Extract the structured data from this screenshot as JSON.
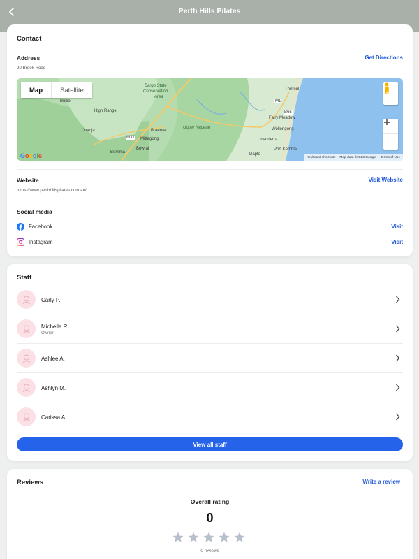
{
  "header": {
    "title": "Perth Hills Pilates"
  },
  "contact": {
    "title": "Contact",
    "address_label": "Address",
    "address_value": "20 Brook Road",
    "directions_link": "Get Directions",
    "map": {
      "map_tab": "Map",
      "satellite_tab": "Satellite",
      "places": [
        "Bargo State",
        "Conservation",
        "Area",
        "Bullio",
        "High Range",
        "Joadja",
        "Braemar",
        "Mittagong",
        "Berrima",
        "Bowral",
        "Upper Nepean",
        "Thirroul",
        "Fairy Meadow",
        "Wollongong",
        "Unanderra",
        "Port Kembla",
        "Dapto"
      ],
      "road_labels": [
        "M31",
        "B65",
        "M1"
      ],
      "keyboard_shortcuts": "Keyboard shortcuts",
      "map_data": "Map data ©2023 Google",
      "terms": "Terms of Use",
      "logo": "Google"
    },
    "website_label": "Website",
    "website_value": "https://www.perthhillspilates.com.au/",
    "visit_website": "Visit Website",
    "social_label": "Social media",
    "social": [
      {
        "name": "Facebook",
        "link": "Visit",
        "icon": "facebook-icon",
        "color": "#1877f2"
      },
      {
        "name": "Instagram",
        "link": "Visit",
        "icon": "instagram-icon",
        "color": "#d6249f"
      }
    ]
  },
  "staff": {
    "title": "Staff",
    "members": [
      {
        "name": "Carly P.",
        "role": ""
      },
      {
        "name": "Michelle R.",
        "role": "Owner"
      },
      {
        "name": "Ashlee A.",
        "role": ""
      },
      {
        "name": "Ashlyn M.",
        "role": ""
      },
      {
        "name": "Carissa A.",
        "role": ""
      }
    ],
    "view_all": "View all staff"
  },
  "reviews": {
    "title": "Reviews",
    "write_link": "Write a review",
    "overall_label": "Overall rating",
    "rating_value": "0",
    "stars_filled": 0,
    "stars_total": 5,
    "count_text": "0 reviews"
  },
  "colors": {
    "accent": "#2563eb",
    "link": "#1f58d6",
    "header_bg": "#a9b0aa",
    "avatar_bg": "#fbe1e6"
  }
}
